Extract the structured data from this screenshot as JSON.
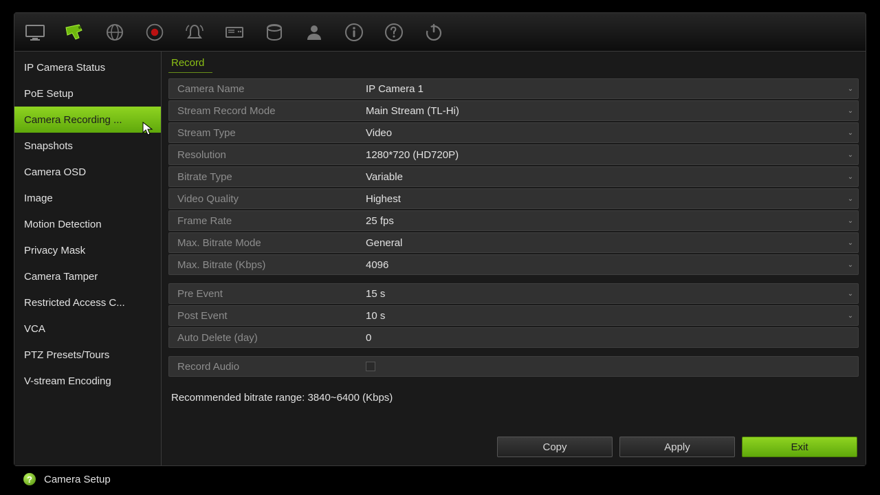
{
  "toolbar": {
    "icons": [
      "monitor",
      "camera",
      "network",
      "record",
      "alarm",
      "device",
      "storage",
      "user",
      "info",
      "help",
      "power"
    ],
    "active_index": 1
  },
  "sidebar": {
    "items": [
      {
        "label": "IP Camera Status"
      },
      {
        "label": "PoE Setup"
      },
      {
        "label": "Camera Recording ..."
      },
      {
        "label": "Snapshots"
      },
      {
        "label": "Camera OSD"
      },
      {
        "label": "Image"
      },
      {
        "label": "Motion Detection"
      },
      {
        "label": "Privacy Mask"
      },
      {
        "label": "Camera Tamper"
      },
      {
        "label": "Restricted Access C..."
      },
      {
        "label": "VCA"
      },
      {
        "label": "PTZ Presets/Tours"
      },
      {
        "label": "V-stream Encoding"
      }
    ],
    "active_index": 2
  },
  "page": {
    "title": "Record"
  },
  "form": {
    "group1": [
      {
        "label": "Camera Name",
        "value": "IP Camera 1",
        "dropdown": true
      },
      {
        "label": "Stream Record Mode",
        "value": "Main Stream (TL-Hi)",
        "dropdown": true
      },
      {
        "label": "Stream Type",
        "value": "Video",
        "dropdown": true
      },
      {
        "label": "Resolution",
        "value": "1280*720 (HD720P)",
        "dropdown": true
      },
      {
        "label": "Bitrate Type",
        "value": "Variable",
        "dropdown": true
      },
      {
        "label": "Video Quality",
        "value": "Highest",
        "dropdown": true
      },
      {
        "label": "Frame Rate",
        "value": "25 fps",
        "dropdown": true
      },
      {
        "label": "Max. Bitrate Mode",
        "value": "General",
        "dropdown": true
      },
      {
        "label": "Max. Bitrate (Kbps)",
        "value": "4096",
        "dropdown": true
      }
    ],
    "group2": [
      {
        "label": "Pre Event",
        "value": "15 s",
        "dropdown": true
      },
      {
        "label": "Post Event",
        "value": "10 s",
        "dropdown": true
      },
      {
        "label": "Auto Delete (day)",
        "value": "0",
        "dropdown": false
      }
    ],
    "group3": [
      {
        "label": "Record Audio",
        "type": "checkbox",
        "checked": false
      }
    ]
  },
  "recommend": "Recommended bitrate range: 3840~6400 (Kbps)",
  "buttons": {
    "copy": "Copy",
    "apply": "Apply",
    "exit": "Exit"
  },
  "status": {
    "label": "Camera Setup"
  }
}
